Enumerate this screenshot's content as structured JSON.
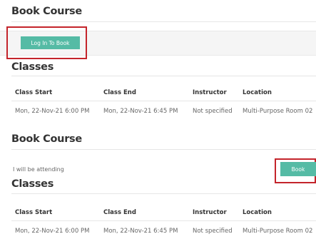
{
  "section_one": {
    "heading": "Book Course",
    "login_button": "Log In To Book",
    "classes_heading": "Classes",
    "table": {
      "headers": [
        "Class Start",
        "Class End",
        "Instructor",
        "Location"
      ],
      "row": [
        "Mon, 22-Nov-21 6:00 PM",
        "Mon, 22-Nov-21 6:45 PM",
        "Not specified",
        "Multi-Purpose Room 02"
      ]
    }
  },
  "section_two": {
    "heading": "Book Course",
    "attending_text": "I will be attending",
    "book_button": "Book",
    "classes_heading": "Classes",
    "table": {
      "headers": [
        "Class Start",
        "Class End",
        "Instructor",
        "Location"
      ],
      "row": [
        "Mon, 22-Nov-21 6:00 PM",
        "Mon, 22-Nov-21 6:45 PM",
        "Not specified",
        "Multi-Purpose Room 02"
      ]
    }
  },
  "colors": {
    "button": "#55bba5",
    "highlight": "#c4242b"
  }
}
